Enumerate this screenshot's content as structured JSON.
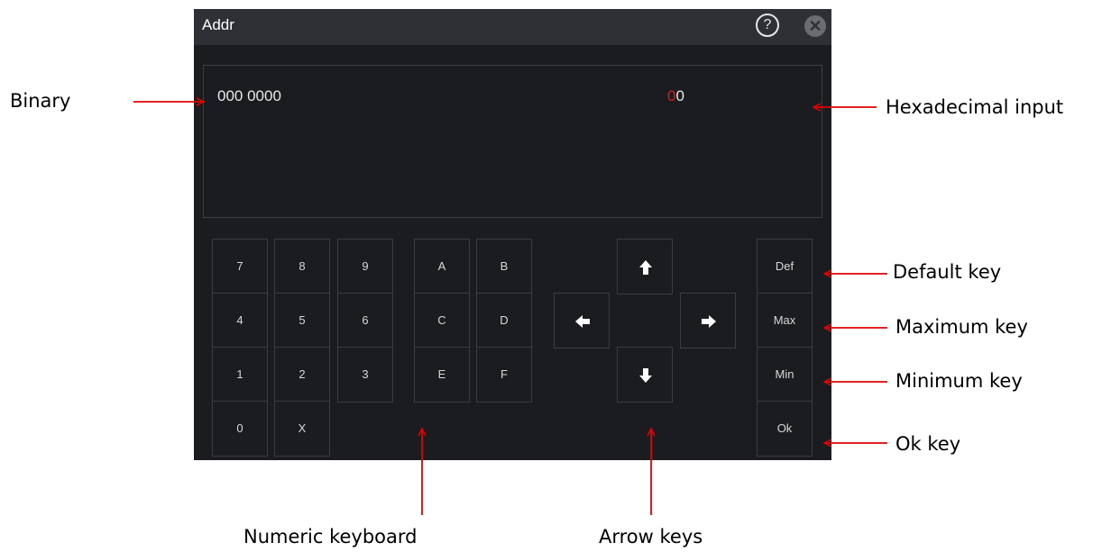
{
  "dialog": {
    "title": "Addr",
    "help_icon": "question-circle-icon",
    "close_icon": "close-circle-icon",
    "help_glyph": "?",
    "close_glyph": "✕"
  },
  "display": {
    "binary": "000 0000",
    "hex_cursor_digit": "0",
    "hex_rest": "0"
  },
  "numeric_keys": [
    "7",
    "8",
    "9",
    "4",
    "5",
    "6",
    "1",
    "2",
    "3",
    "0",
    "X"
  ],
  "hex_keys": [
    "A",
    "B",
    "C",
    "D",
    "E",
    "F"
  ],
  "arrow_keys": [
    "up",
    "left",
    "right",
    "down"
  ],
  "function_keys": {
    "def": "Def",
    "max": "Max",
    "min": "Min",
    "ok": "Ok"
  },
  "annotations": {
    "binary": "Binary",
    "hex_input": "Hexadecimal input",
    "default_key": "Default key",
    "maximum_key": "Maximum key",
    "minimum_key": "Minimum key",
    "ok_key": "Ok key",
    "numeric_keyboard": "Numeric keyboard",
    "arrow_keys": "Arrow keys"
  },
  "colors": {
    "dialog_bg": "#1b1c20",
    "titlebar_bg": "#2f3035",
    "cursor": "#e11a1a",
    "annotation_arrow": "#e00000"
  }
}
